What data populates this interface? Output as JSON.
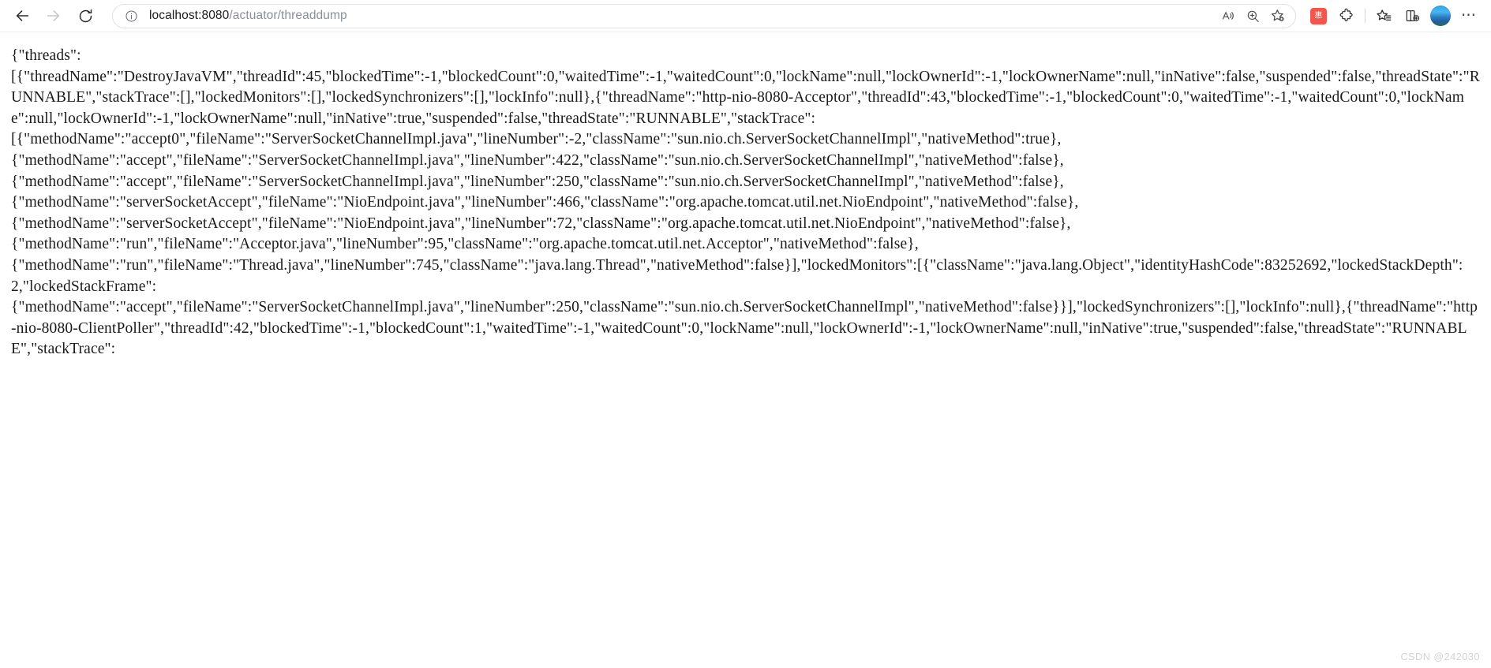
{
  "browser": {
    "back_label": "Back",
    "forward_label": "Forward",
    "refresh_label": "Refresh",
    "info_icon": "info-circle-icon",
    "url_host": "localhost:8080",
    "url_path": "/actuator/threaddump",
    "url_full": "localhost:8080/actuator/threaddump",
    "read_aloud_label": "Read aloud",
    "zoom_label": "Zoom",
    "favorite_label": "Add this page to favorites",
    "extension_badge_label": "惠",
    "extension_puzzle_label": "Extensions",
    "collections_label": "Favorites",
    "split_screen_label": "Split screen",
    "profile_label": "Profile",
    "settings_label": "Settings and more"
  },
  "content": {
    "body_text": "{\"threads\":\n[{\"threadName\":\"DestroyJavaVM\",\"threadId\":45,\"blockedTime\":-1,\"blockedCount\":0,\"waitedTime\":-1,\"waitedCount\":0,\"lockName\":null,\"lockOwnerId\":-1,\"lockOwnerName\":null,\"inNative\":false,\"suspended\":false,\"threadState\":\"RUNNABLE\",\"stackTrace\":[],\"lockedMonitors\":[],\"lockedSynchronizers\":[],\"lockInfo\":null},{\"threadName\":\"http-nio-8080-Acceptor\",\"threadId\":43,\"blockedTime\":-1,\"blockedCount\":0,\"waitedTime\":-1,\"waitedCount\":0,\"lockName\":null,\"lockOwnerId\":-1,\"lockOwnerName\":null,\"inNative\":true,\"suspended\":false,\"threadState\":\"RUNNABLE\",\"stackTrace\":\n[{\"methodName\":\"accept0\",\"fileName\":\"ServerSocketChannelImpl.java\",\"lineNumber\":-2,\"className\":\"sun.nio.ch.ServerSocketChannelImpl\",\"nativeMethod\":true},\n{\"methodName\":\"accept\",\"fileName\":\"ServerSocketChannelImpl.java\",\"lineNumber\":422,\"className\":\"sun.nio.ch.ServerSocketChannelImpl\",\"nativeMethod\":false},\n{\"methodName\":\"accept\",\"fileName\":\"ServerSocketChannelImpl.java\",\"lineNumber\":250,\"className\":\"sun.nio.ch.ServerSocketChannelImpl\",\"nativeMethod\":false},\n{\"methodName\":\"serverSocketAccept\",\"fileName\":\"NioEndpoint.java\",\"lineNumber\":466,\"className\":\"org.apache.tomcat.util.net.NioEndpoint\",\"nativeMethod\":false},\n{\"methodName\":\"serverSocketAccept\",\"fileName\":\"NioEndpoint.java\",\"lineNumber\":72,\"className\":\"org.apache.tomcat.util.net.NioEndpoint\",\"nativeMethod\":false},\n{\"methodName\":\"run\",\"fileName\":\"Acceptor.java\",\"lineNumber\":95,\"className\":\"org.apache.tomcat.util.net.Acceptor\",\"nativeMethod\":false},\n{\"methodName\":\"run\",\"fileName\":\"Thread.java\",\"lineNumber\":745,\"className\":\"java.lang.Thread\",\"nativeMethod\":false}],\"lockedMonitors\":[{\"className\":\"java.lang.Object\",\"identityHashCode\":83252692,\"lockedStackDepth\":2,\"lockedStackFrame\":\n{\"methodName\":\"accept\",\"fileName\":\"ServerSocketChannelImpl.java\",\"lineNumber\":250,\"className\":\"sun.nio.ch.ServerSocketChannelImpl\",\"nativeMethod\":false}}],\"lockedSynchronizers\":[],\"lockInfo\":null},{\"threadName\":\"http-nio-8080-ClientPoller\",\"threadId\":42,\"blockedTime\":-1,\"blockedCount\":1,\"waitedTime\":-1,\"waitedCount\":0,\"lockName\":null,\"lockOwnerId\":-1,\"lockOwnerName\":null,\"inNative\":true,\"suspended\":false,\"threadState\":\"RUNNABLE\",\"stackTrace\":"
  },
  "watermark": {
    "text": "CSDN @242030"
  }
}
